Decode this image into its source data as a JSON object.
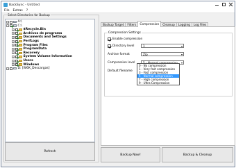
{
  "window": {
    "title": "BackSync - Untitled"
  },
  "menu": [
    "File",
    "Extras",
    "?"
  ],
  "left": {
    "caption": "Select Directories for Backup",
    "tree": [
      {
        "label": "A:\\",
        "bold": false
      },
      {
        "label": "C:\\",
        "bold": false
      },
      {
        "label": "$Recycle.Bin",
        "bold": true
      },
      {
        "label": "Archivos de programa",
        "bold": true
      },
      {
        "label": "Documents and Settings",
        "bold": true
      },
      {
        "label": "PerfLogs",
        "bold": true
      },
      {
        "label": "Program Files",
        "bold": true
      },
      {
        "label": "ProgramData",
        "bold": true
      },
      {
        "label": "Recovery",
        "bold": true
      },
      {
        "label": "System Volume Information",
        "bold": true
      },
      {
        "label": "Users",
        "bold": true
      },
      {
        "label": "Windows",
        "bold": true
      },
      {
        "label": "D: [W6K_Descargas]",
        "bold": false
      }
    ],
    "refresh": "Refresh"
  },
  "tabs": [
    "Backup Target",
    "Filters",
    "Compression",
    "Cleanup",
    "Logging",
    "Log Files"
  ],
  "compression": {
    "caption": "Compression Settings",
    "enable_label": "Enable compression",
    "dirlevel_label": "Directory level",
    "dirlevel_value": "1",
    "archive_label": "Archive format",
    "archive_value": "Zip",
    "level_label": "Compression level",
    "level_value": "5 - Normal compression",
    "filename_label": "Default filename",
    "options": [
      "0 - No compression",
      "1 - Very fast compression",
      "3 - Fast compression",
      "5 - Normal compression",
      "7 - High compression",
      "9 - Ultra Compression"
    ],
    "selected_index": 3
  },
  "buttons": {
    "backup_now": "Backup Now!",
    "backup_cleanup": "Backup & Cleanup"
  },
  "colors": {
    "selection": "#3399ff",
    "folder": "#e8c250"
  }
}
